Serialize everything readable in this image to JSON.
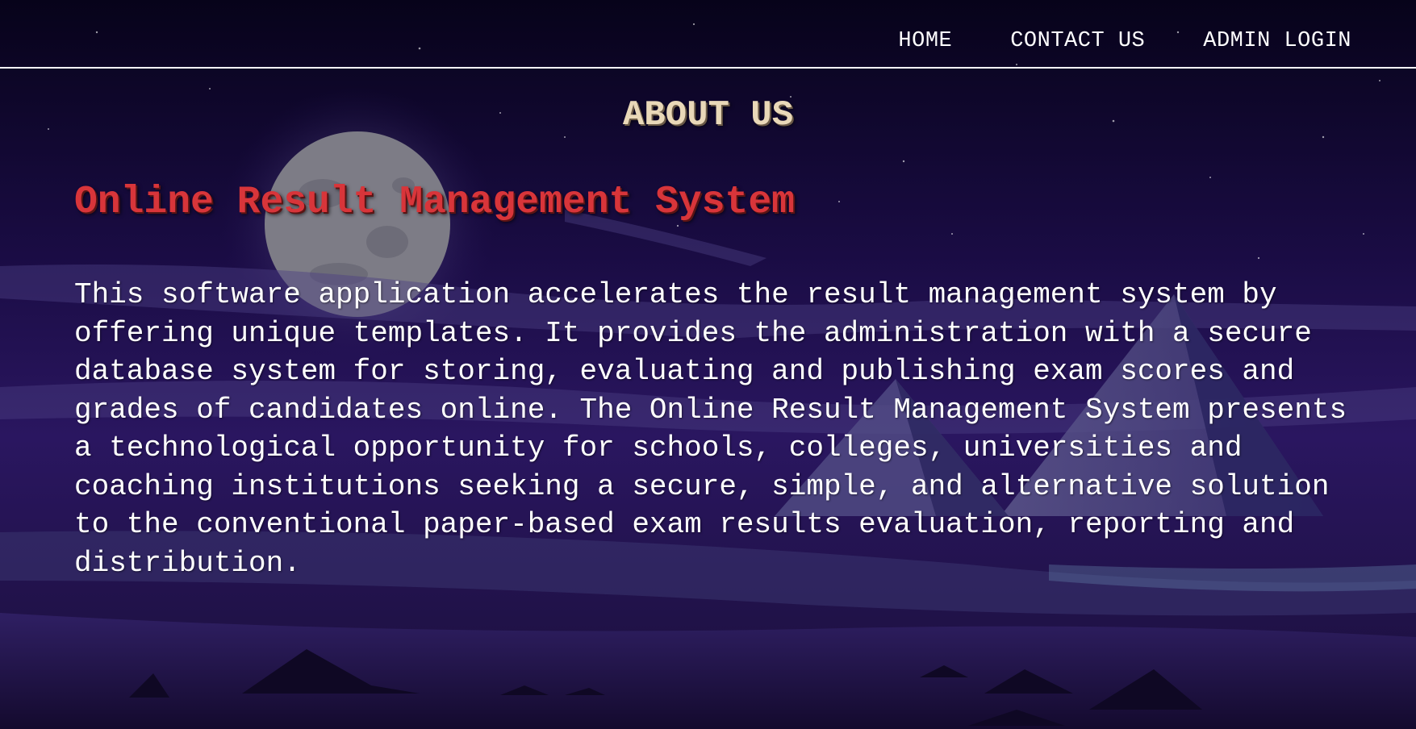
{
  "nav": {
    "items": [
      {
        "label": "HOME"
      },
      {
        "label": "CONTACT US"
      },
      {
        "label": "ADMIN LOGIN"
      }
    ]
  },
  "about": {
    "heading": "ABOUT US",
    "system_title": "Online Result Management System",
    "description": "This software application accelerates the result management system by offering unique templates. It provides the administration with a secure database system for storing, evaluating and publishing exam scores and grades of candidates online. The Online Result Management System presents a technological opportunity for schools, colleges, universities and coaching institutions seeking a secure, simple, and alternative solution to the conventional paper-based exam results evaluation, reporting and distribution."
  },
  "colors": {
    "sky_top": "#07031a",
    "sky_mid": "#1e0f4a",
    "ground": "#1a0f3a",
    "heading": "#e9d8b8",
    "system_title": "#d8353a",
    "text": "#ffffff"
  },
  "background": {
    "scene": "night-desert-pyramids-moon-illustration"
  }
}
